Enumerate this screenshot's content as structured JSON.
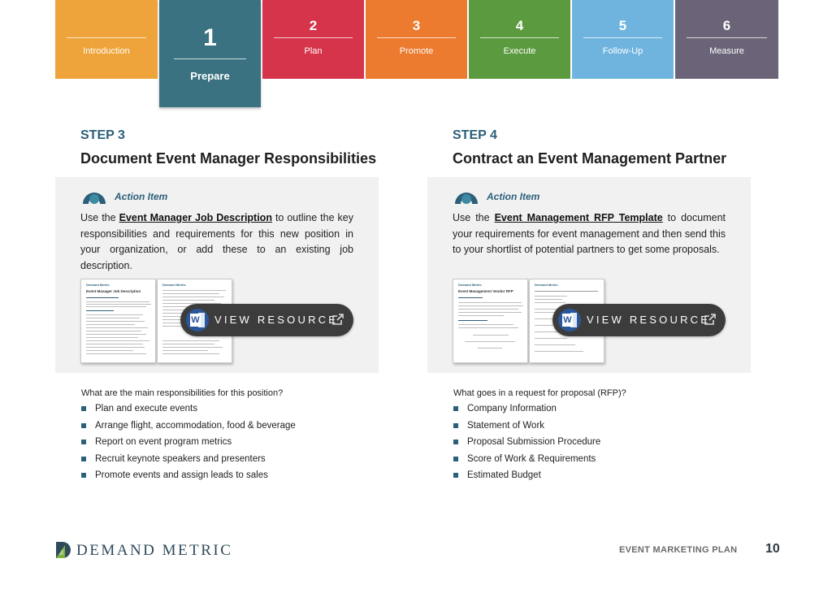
{
  "tabs": [
    {
      "number": "",
      "label": "Introduction",
      "color": "#eea43a"
    },
    {
      "number": "1",
      "label": "Prepare",
      "color": "#3a7281",
      "active": true
    },
    {
      "number": "2",
      "label": "Plan",
      "color": "#d6344a"
    },
    {
      "number": "3",
      "label": "Promote",
      "color": "#ec7a2f"
    },
    {
      "number": "4",
      "label": "Execute",
      "color": "#5c9a3f"
    },
    {
      "number": "5",
      "label": "Follow-Up",
      "color": "#6fb4de"
    },
    {
      "number": "6",
      "label": "Measure",
      "color": "#6b6478"
    }
  ],
  "step3": {
    "kicker": "STEP 3",
    "title": "Document Event Manager Responsibilities",
    "action_item_label": "Action Item",
    "text_before": "Use the ",
    "link": "Event Manager Job Description",
    "text_after": " to outline the key responsibilities and requirements for this new position in your organization, or add these to an existing job description.",
    "view_resource": "VIEW RESOURCE",
    "question": "What are the main responsibilities for this position?",
    "bullets": [
      "Plan and execute events",
      "Arrange flight, accommodation, food & beverage",
      "Report on event program metrics",
      "Recruit keynote speakers and presenters",
      "Promote events and assign leads to sales"
    ],
    "thumb_brand": "Demand Metric",
    "thumb_title": "Event Manager Job Description"
  },
  "step4": {
    "kicker": "STEP 4",
    "title": "Contract an Event Management Partner",
    "action_item_label": "Action Item",
    "text_before": "Use the ",
    "link": "Event Management RFP Template",
    "text_after": " to document your requirements for event management and then send this to your shortlist of potential partners to get some proposals.",
    "view_resource": "VIEW RESOURCE",
    "question": "What goes in a request for proposal (RFP)?",
    "bullets": [
      "Company Information",
      "Statement of Work",
      "Proposal Submission Procedure",
      "Score of Work & Requirements",
      "Estimated Budget"
    ],
    "thumb_brand": "Demand Metric",
    "thumb_title": "Event Management Vendor RFP"
  },
  "footer": {
    "logo_text": "DEMAND METRIC",
    "section_label": "EVENT MARKETING PLAN",
    "page_number": "10"
  },
  "colors": {
    "accent": "#2c5f7a",
    "panel": "#f1f1f1",
    "button": "#3c3c3c",
    "word_blue": "#2b579a"
  }
}
